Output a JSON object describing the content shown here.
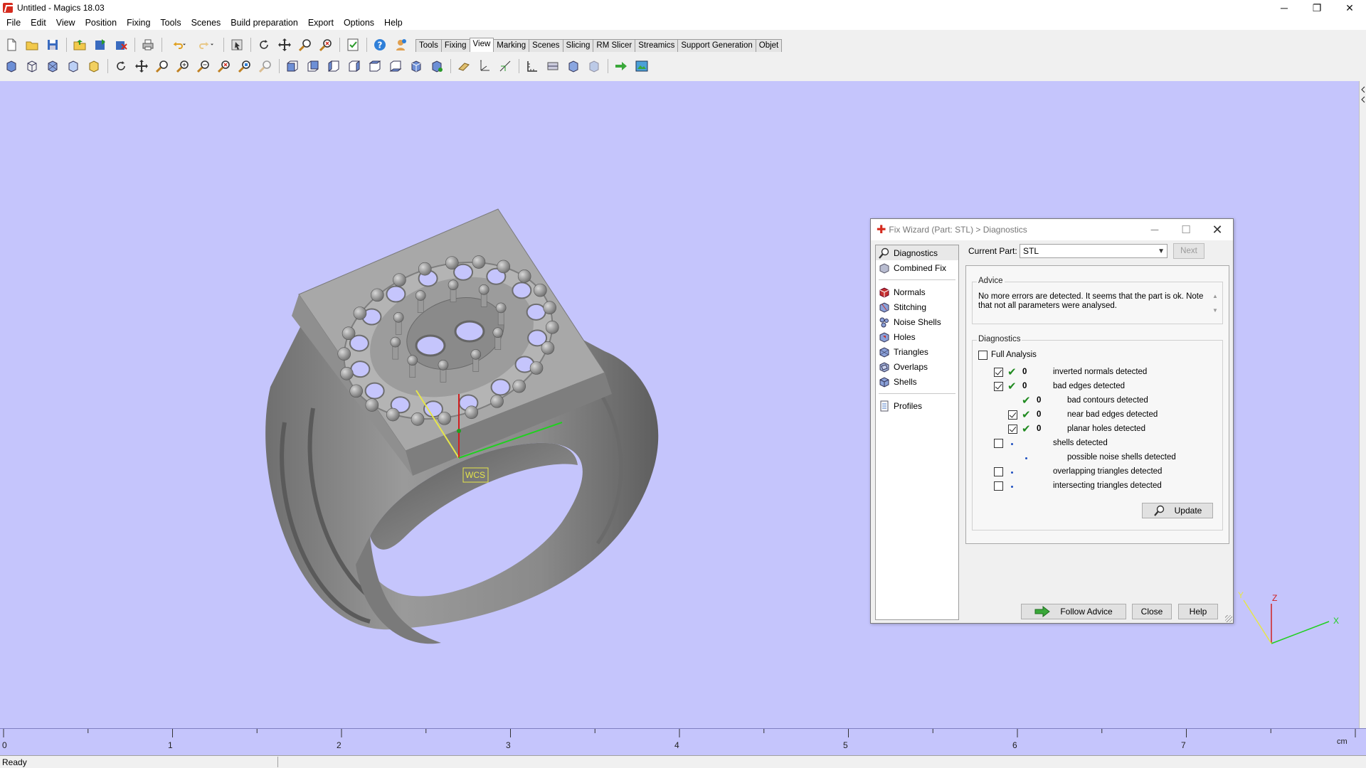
{
  "window": {
    "title": "Untitled - Magics 18.03",
    "minimize": "─",
    "restore": "❐",
    "close": "✕"
  },
  "menu": [
    "File",
    "Edit",
    "View",
    "Position",
    "Fixing",
    "Tools",
    "Scenes",
    "Build preparation",
    "Export",
    "Options",
    "Help"
  ],
  "tabs": [
    "Tools",
    "Fixing",
    "View",
    "Marking",
    "Scenes",
    "Slicing",
    "RM Slicer",
    "Streamics",
    "Support Generation",
    "Objet"
  ],
  "active_tab": "View",
  "viewport": {
    "background": "#c5c5fc",
    "wcs_label": "WCS",
    "axis_x": "X",
    "axis_y": "Y",
    "axis_z": "Z"
  },
  "ruler": {
    "labels": [
      "0",
      "1",
      "2",
      "3",
      "4",
      "5",
      "6",
      "7"
    ],
    "unit": "cm"
  },
  "status": "Ready",
  "dialog": {
    "title": "Fix Wizard (Part: STL) > Diagnostics",
    "nav_top": [
      "Diagnostics",
      "Combined Fix"
    ],
    "nav_mid": [
      "Normals",
      "Stitching",
      "Noise Shells",
      "Holes",
      "Triangles",
      "Overlaps",
      "Shells"
    ],
    "nav_bottom": [
      "Profiles"
    ],
    "current_part_label": "Current Part:",
    "current_part_value": "STL",
    "next_label": "Next",
    "advice_title": "Advice",
    "advice_text": "No more errors are detected. It seems that the part is ok. Note that not all parameters were analysed.",
    "diagnostics_title": "Diagnostics",
    "full_analysis_label": "Full Analysis",
    "rows": {
      "r1": {
        "count": "0",
        "label": "inverted normals detected"
      },
      "r2": {
        "count": "0",
        "label": "bad edges detected"
      },
      "r3": {
        "count": "0",
        "label": "bad contours detected"
      },
      "r4": {
        "count": "0",
        "label": "near bad edges detected"
      },
      "r5": {
        "count": "0",
        "label": "planar holes detected"
      },
      "r6": {
        "label": "shells detected"
      },
      "r7": {
        "label": "possible noise shells detected"
      },
      "r8": {
        "label": "overlapping triangles detected"
      },
      "r9": {
        "label": "intersecting triangles detected"
      }
    },
    "update_label": "Update",
    "follow_advice_label": "Follow Advice",
    "close_label": "Close",
    "help_label": "Help"
  },
  "colors": {
    "accent_red": "#d52b1e",
    "check_green": "#1f8a1f",
    "ring_gray": "#8c8c8c"
  }
}
